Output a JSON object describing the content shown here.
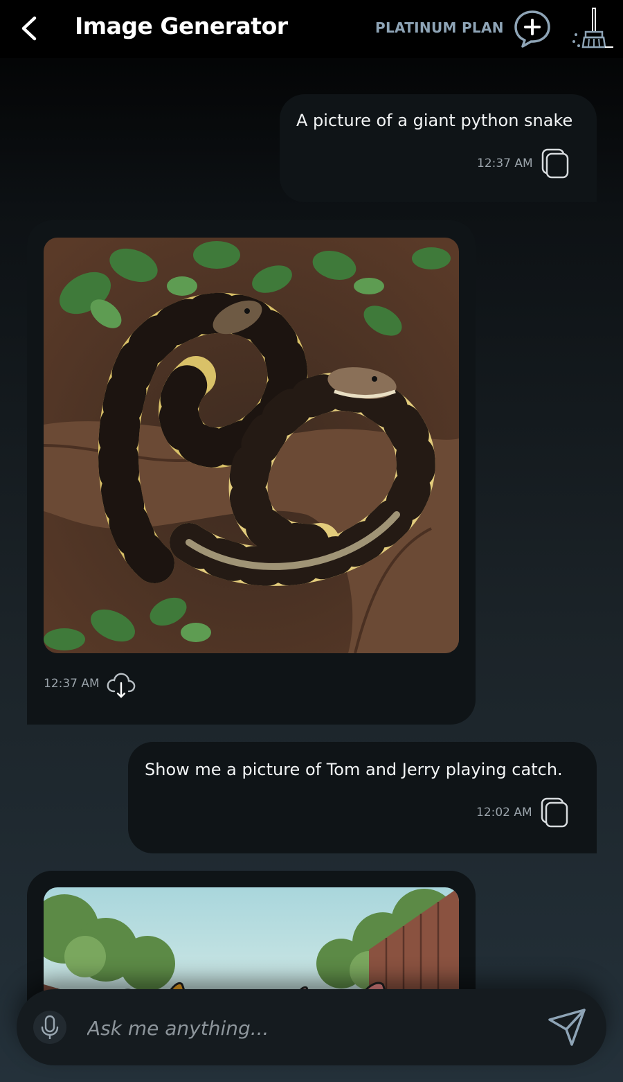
{
  "header": {
    "title": "Image Generator",
    "plan_label": "PLATINUM PLAN",
    "back_icon": "chevron-left-icon",
    "new_chat_icon": "chat-plus-icon",
    "clear_icon": "broom-icon"
  },
  "messages": [
    {
      "role": "user",
      "text": "A picture of a giant python snake",
      "time": "12:37 AM",
      "action_icon": "copy-icon"
    },
    {
      "role": "assistant",
      "image": "generated image of a coiled yellow and black python on tree bark with green leaves",
      "time": "12:37 AM",
      "action_icon": "download-cloud-icon"
    },
    {
      "role": "user",
      "text": "Show me a picture of Tom and Jerry playing catch.",
      "time": "12:02 AM",
      "action_icon": "copy-icon"
    },
    {
      "role": "assistant",
      "image": "cartoon image of a backyard with trees and wooden fences (partially visible)"
    }
  ],
  "input": {
    "placeholder": "Ask me anything...",
    "mic_icon": "microphone-icon",
    "send_icon": "send-icon"
  },
  "colors": {
    "accent": "#8ea4b6",
    "bubble": "#0f1417",
    "header_bg": "#000000"
  }
}
